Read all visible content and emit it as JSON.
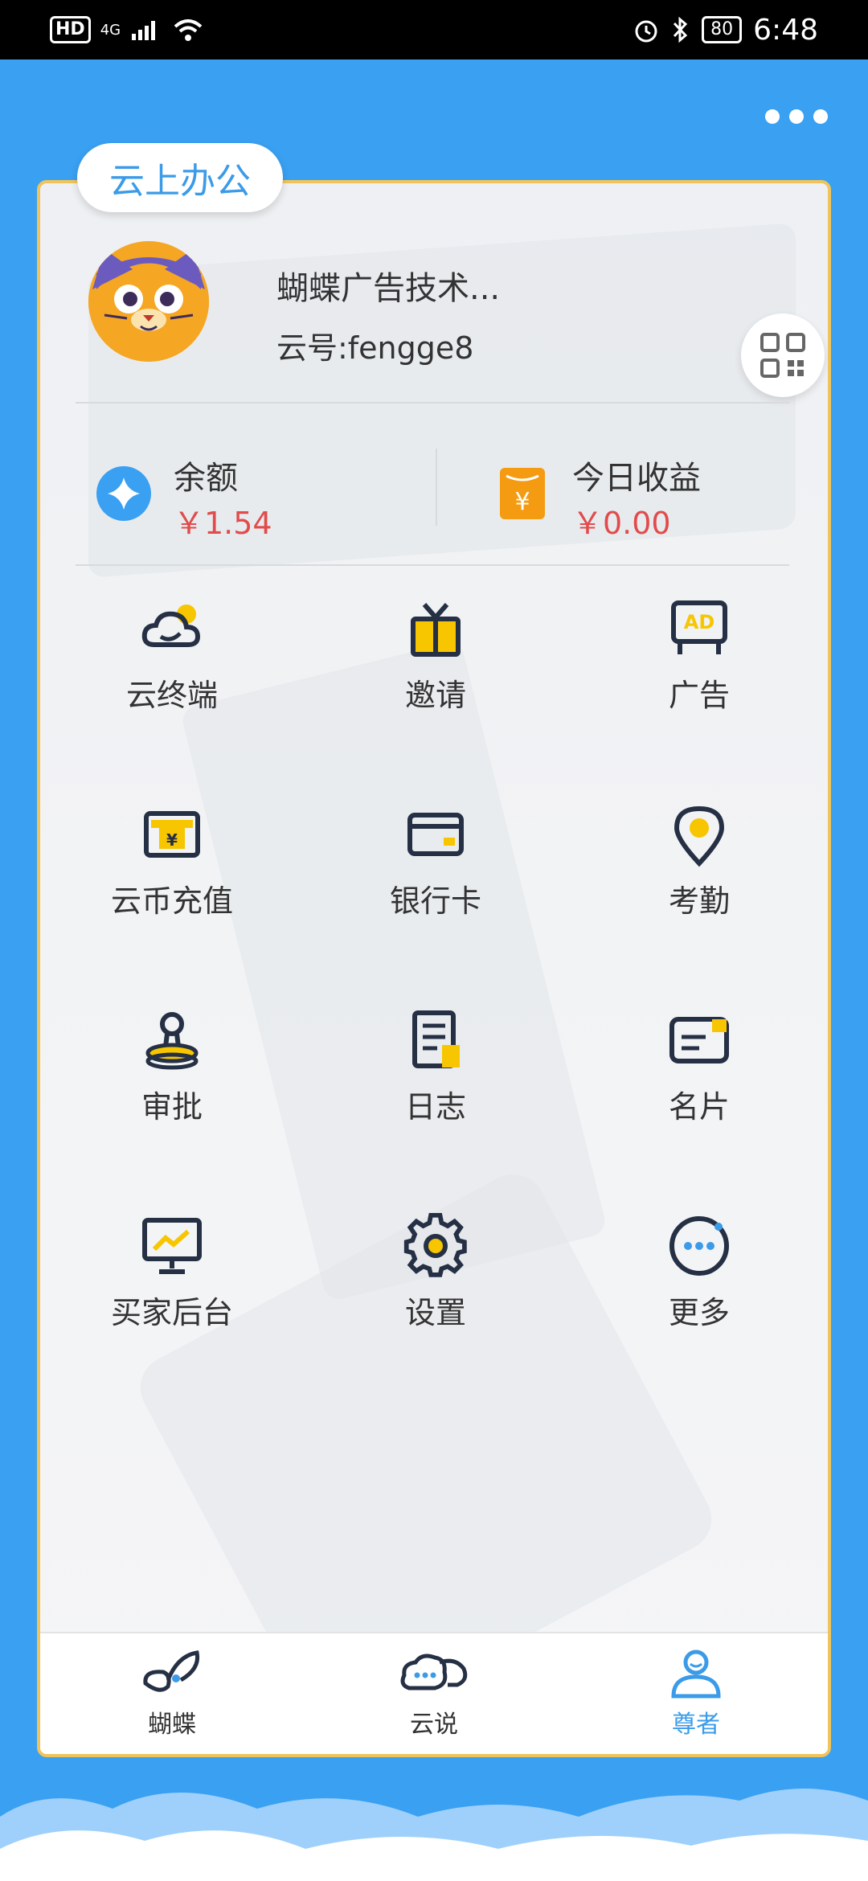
{
  "status_bar": {
    "hd": "HD",
    "network": "4G",
    "battery": "80",
    "time": "6:48"
  },
  "header": {
    "section_tag": "云上办公"
  },
  "profile": {
    "name": "蝴蝶广告技术...",
    "cloud_id": "云号:fengge8"
  },
  "stats": [
    {
      "label": "余额",
      "value": "￥1.54",
      "icon": "diamond-icon"
    },
    {
      "label": "今日收益",
      "value": "￥0.00",
      "icon": "yen-bag-icon"
    }
  ],
  "menu": [
    {
      "label": "云终端",
      "icon": "cloud-terminal-icon"
    },
    {
      "label": "邀请",
      "icon": "gift-icon"
    },
    {
      "label": "广告",
      "icon": "ad-board-icon"
    },
    {
      "label": "云币充值",
      "icon": "coin-card-icon"
    },
    {
      "label": "银行卡",
      "icon": "bank-card-icon"
    },
    {
      "label": "考勤",
      "icon": "location-pin-icon"
    },
    {
      "label": "审批",
      "icon": "stamp-icon"
    },
    {
      "label": "日志",
      "icon": "log-document-icon"
    },
    {
      "label": "名片",
      "icon": "business-card-icon"
    },
    {
      "label": "买家后台",
      "icon": "monitor-chart-icon"
    },
    {
      "label": "设置",
      "icon": "gear-icon"
    },
    {
      "label": "更多",
      "icon": "more-circle-icon"
    }
  ],
  "tabs": [
    {
      "label": "蝴蝶",
      "icon": "butterfly-icon",
      "active": false
    },
    {
      "label": "云说",
      "icon": "chat-cloud-icon",
      "active": false
    },
    {
      "label": "尊者",
      "icon": "user-icon",
      "active": true
    }
  ],
  "colors": {
    "background": "#3aa0f2",
    "accent": "#3b9be8",
    "money": "#e24b4b",
    "icon_yellow": "#f7c600",
    "icon_dark": "#263045",
    "card_border": "#f0c45a"
  }
}
